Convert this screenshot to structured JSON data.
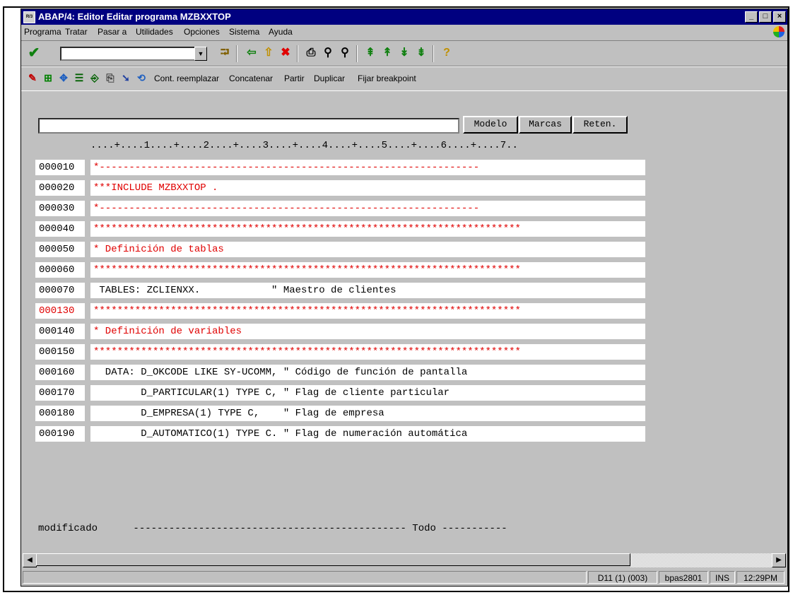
{
  "window": {
    "title": "ABAP/4: Editor Editar programa MZBXXTOP",
    "sys_icon": "R/3",
    "buttons": {
      "minimize": "_",
      "maximize": "□",
      "close": "×"
    }
  },
  "menu": [
    "Programa",
    "Tratar",
    "Pasar a",
    "Utilidades",
    "Opciones",
    "Sistema",
    "Ayuda"
  ],
  "toolbar1": {
    "command_value": "",
    "icons": [
      "check-icon",
      "dropdown-icon",
      "enter-icon",
      "back-icon",
      "exit-icon",
      "cancel-icon",
      "print-icon",
      "find-icon",
      "find-next-icon",
      "first-page-icon",
      "prev-page-icon",
      "next-page-icon",
      "last-page-icon",
      "help-icon"
    ]
  },
  "toolbar2": {
    "icons": [
      "syntax-check-icon",
      "hierarchy-icon",
      "navigate-icon",
      "pretty-print-icon",
      "insert-icon",
      "paste-icon",
      "select-icon",
      "replace-icon"
    ],
    "buttons": [
      "Cont. reemplazar",
      "Concatenar",
      "Partir",
      "Duplicar",
      "Fijar breakpoint"
    ]
  },
  "find_field": {
    "value": ""
  },
  "find_buttons": [
    "Modelo",
    "Marcas",
    "Reten."
  ],
  "ruler": "....+....1....+....2....+....3....+....4....+....5....+....6....+....7..",
  "lines": [
    {
      "num": "000010",
      "text": "*----------------------------------------------------------------",
      "num_red": false,
      "text_red": true
    },
    {
      "num": "000020",
      "text": "***INCLUDE MZBXXTOP .",
      "num_red": false,
      "text_red": true
    },
    {
      "num": "000030",
      "text": "*----------------------------------------------------------------",
      "num_red": false,
      "text_red": true
    },
    {
      "num": "000040",
      "text": "************************************************************************",
      "num_red": false,
      "text_red": true
    },
    {
      "num": "000050",
      "text": "* Definición de tablas",
      "num_red": false,
      "text_red": true
    },
    {
      "num": "000060",
      "text": "************************************************************************",
      "num_red": false,
      "text_red": true
    },
    {
      "num": "000070",
      "text": " TABLES: ZCLIENXX.            \" Maestro de clientes",
      "num_red": false,
      "text_red": false
    },
    {
      "num": "000130",
      "text": "************************************************************************",
      "num_red": true,
      "text_red": true
    },
    {
      "num": "000140",
      "text": "* Definición de variables",
      "num_red": false,
      "text_red": true
    },
    {
      "num": "000150",
      "text": "************************************************************************",
      "num_red": false,
      "text_red": true
    },
    {
      "num": "000160",
      "text": "  DATA: D_OKCODE LIKE SY-UCOMM, \" Código de función de pantalla",
      "num_red": false,
      "text_red": false
    },
    {
      "num": "000170",
      "text": "        D_PARTICULAR(1) TYPE C, \" Flag de cliente particular",
      "num_red": false,
      "text_red": false
    },
    {
      "num": "000180",
      "text": "        D_EMPRESA(1) TYPE C,    \" Flag de empresa",
      "num_red": false,
      "text_red": false
    },
    {
      "num": "000190",
      "text": "        D_AUTOMATICO(1) TYPE C. \" Flag de numeración automática",
      "num_red": false,
      "text_red": false
    }
  ],
  "modified_line": "modificado      ---------------------------------------------- Todo -----------",
  "status": {
    "system": "D11 (1) (003)",
    "server": "bpas2801",
    "mode": "INS",
    "time": "12:29PM"
  },
  "colors": {
    "title_bar": "#000080",
    "window_bg": "#c0c0c0",
    "code_red": "#e00000"
  }
}
